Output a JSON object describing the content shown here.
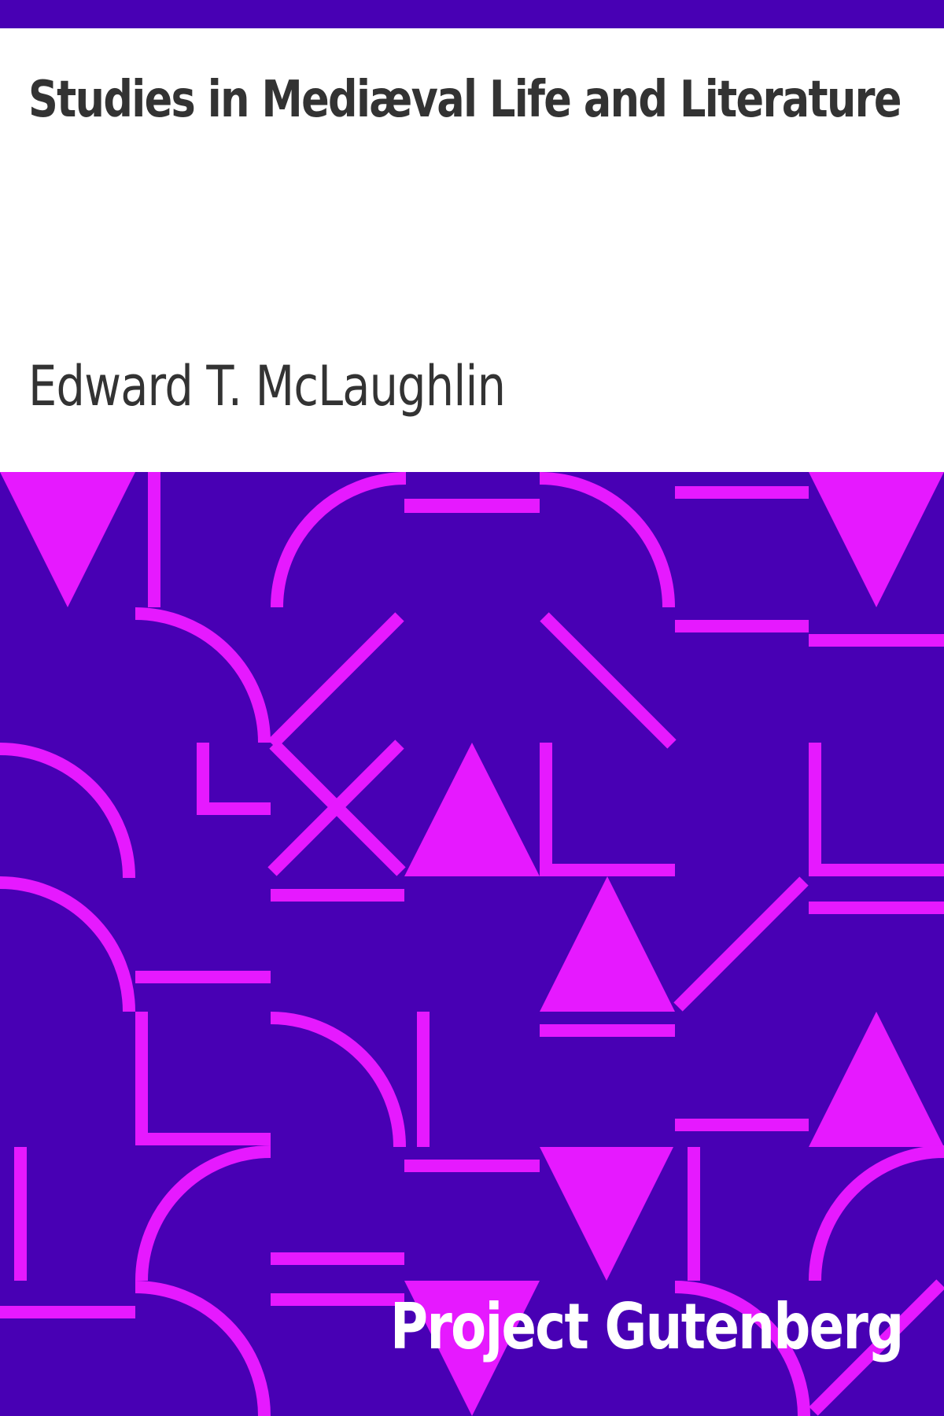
{
  "cover": {
    "title": "Studies in Mediæval Life and Literature",
    "author": "Edward T. McLaughlin",
    "publisher": "Project Gutenberg"
  },
  "colors": {
    "background": "#4800b4",
    "pattern": "#e619ff",
    "text_dark": "#333333",
    "text_light": "#ffffff",
    "title_area": "#ffffff"
  }
}
